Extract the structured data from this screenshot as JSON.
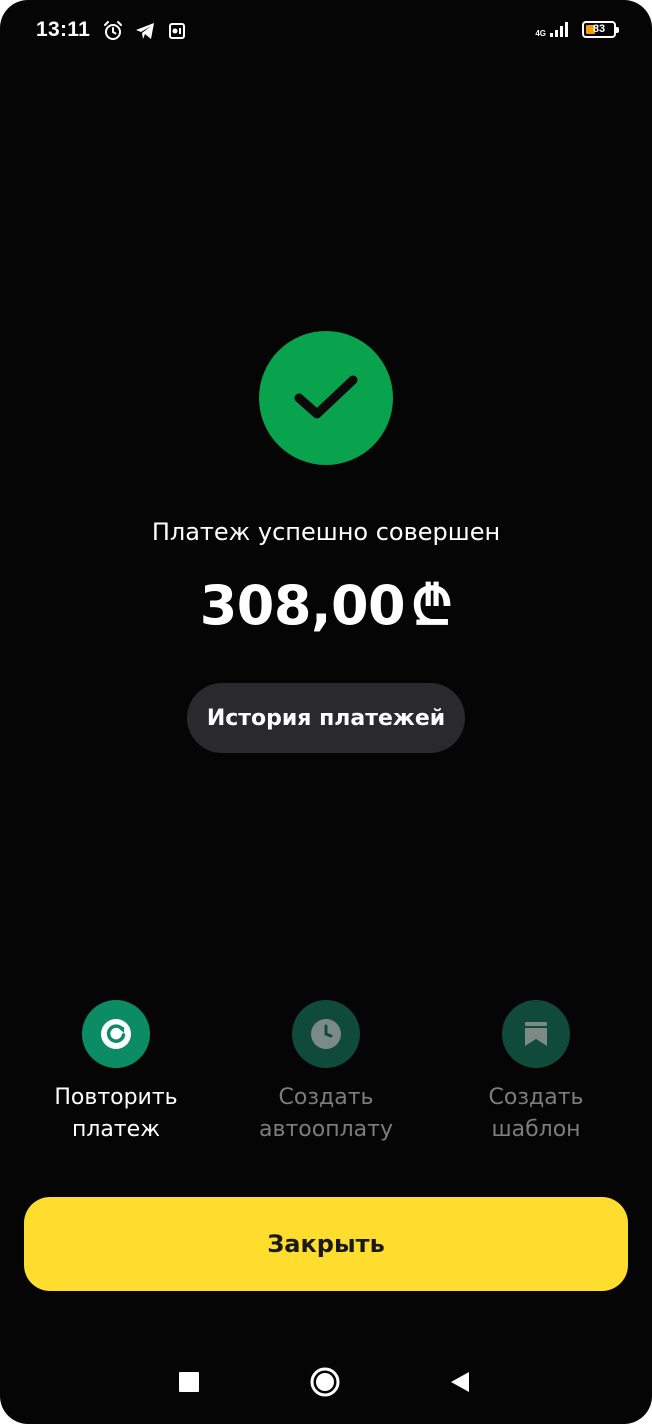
{
  "status_bar": {
    "time": "13:11",
    "network": "4G",
    "battery": "83",
    "icons": [
      "alarm-icon",
      "telegram-icon",
      "notification-icon",
      "signal-icon",
      "battery-icon"
    ]
  },
  "success": {
    "icon": "checkmark-icon",
    "message": "Платеж успешно совершен",
    "amount": "308,00",
    "currency": "₾"
  },
  "history_button": {
    "label": "История платежей"
  },
  "actions": [
    {
      "label": "Повторить\nплатеж",
      "icon": "repeat-icon",
      "enabled": true
    },
    {
      "label": "Создать\nавтооплату",
      "icon": "clock-icon",
      "enabled": false
    },
    {
      "label": "Создать\nшаблон",
      "icon": "bookmark-icon",
      "enabled": false
    }
  ],
  "close_button": {
    "label": "Закрыть"
  },
  "nav_bar": {
    "icons": [
      "recents-square-icon",
      "home-circle-icon",
      "back-triangle-icon"
    ]
  },
  "colors": {
    "background": "#050505",
    "success_green": "#0aa34d",
    "action_green": "#0b8c64",
    "action_disabled": "#0f4a3a",
    "close_yellow": "#fedd2e",
    "history_bg": "#2a2a2c"
  }
}
